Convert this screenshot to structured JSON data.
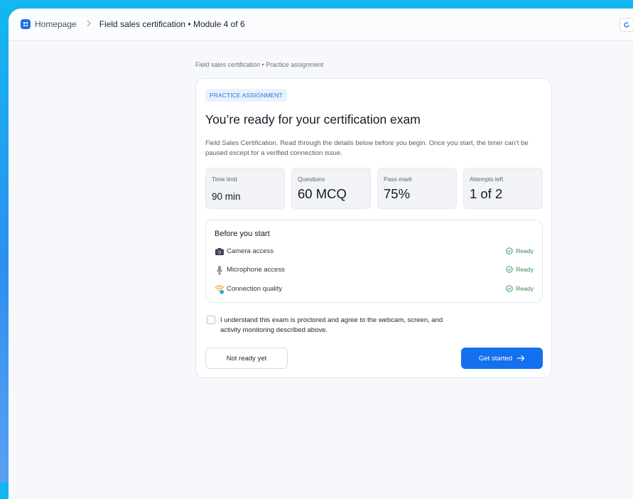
{
  "breadcrumb": {
    "home": "Homepage",
    "separator": ">",
    "current": "Field sales certification • Module 4 of 6"
  },
  "content_label": "Field sales certification • Practice assignment",
  "card": {
    "tag": "PRACTICE ASSIGNMENT",
    "title": "You’re ready for your certification exam",
    "description": "Field Sales Certification. Read through the details below before you begin. Once you start, the timer can’t be paused except for a verified connection issue."
  },
  "stats": [
    {
      "label": "Time limit",
      "value": "90 min"
    },
    {
      "label": "Questions",
      "value": "60 MCQ"
    },
    {
      "label": "Pass mark",
      "value": "75%"
    },
    {
      "label": "Attempts left",
      "value": "1 of 2"
    }
  ],
  "checklist": {
    "heading": "Before you start",
    "items": [
      {
        "label": "Camera access",
        "status": "Ready",
        "icon": "camera-icon"
      },
      {
        "label": "Microphone access",
        "status": "Ready",
        "icon": "microphone-icon"
      },
      {
        "label": "Connection quality",
        "status": "Ready",
        "icon": "wifi-icon"
      }
    ]
  },
  "agreement": "I understand this exam is proctored and agree to the webcam, screen, and activity monitoring described above.",
  "buttons": {
    "secondary": "Not ready yet",
    "primary": "Get started"
  },
  "colors": {
    "accent": "#1470ee",
    "ready": "#2e8a4d",
    "tag_bg": "#e8f2fd"
  }
}
